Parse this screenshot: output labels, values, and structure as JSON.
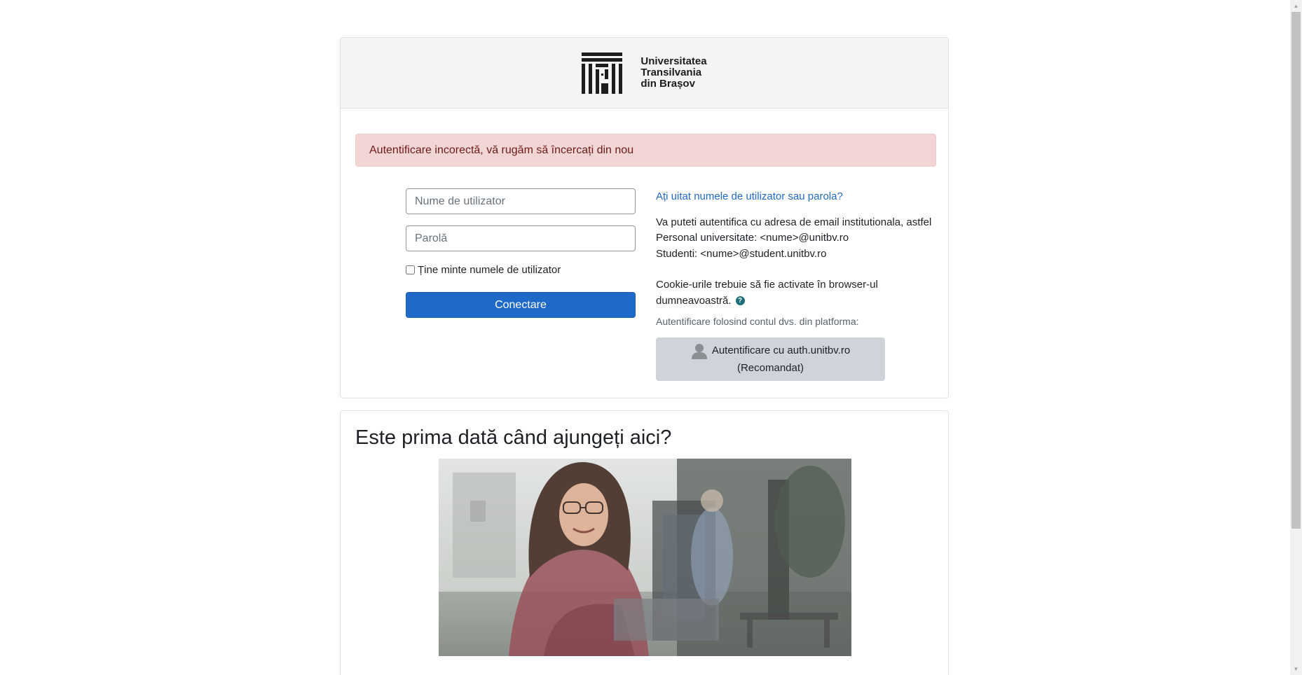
{
  "header": {
    "logo_lines": [
      "Universitatea",
      "Transilvania",
      "din Brașov"
    ]
  },
  "alert": {
    "message": "Autentificare incorectă, vă rugăm să încercați din nou"
  },
  "login_form": {
    "username_placeholder": "Nume de utilizator",
    "password_placeholder": "Parolă",
    "remember_label": "Ține minte numele de utilizator",
    "remember_checked": false,
    "submit_label": "Conectare"
  },
  "info": {
    "forgot_link": "Ați uitat numele de utilizator sau parola?",
    "email_intro": "Va puteti autentifica cu adresa de email institutionala, astfel",
    "staff_line": "Personal universitate: <nume>@unitbv.ro",
    "student_line": "Studenti: <nume>@student.unitbv.ro",
    "cookie_notice": "Cookie-urile trebuie să fie activate în browser-ul dumneavoastră.",
    "help_icon": "question-circle-icon",
    "idp_label": "Autentificare folosind contul dvs. din platforma:",
    "idp_button_line1": "Autentificare cu auth.unitbv.ro",
    "idp_button_line2": "(Recomandat)",
    "idp_icon": "user-silhouette-icon"
  },
  "first_time": {
    "title": "Este prima dată când ajungeți aici?"
  },
  "colors": {
    "primary_button": "#1f6ac8",
    "link": "#1f6ac8",
    "alert_bg": "#f2d6d5",
    "alert_text": "#6e1a17",
    "header_bg": "#f4f4f4",
    "idp_button_bg": "#ced4da"
  }
}
